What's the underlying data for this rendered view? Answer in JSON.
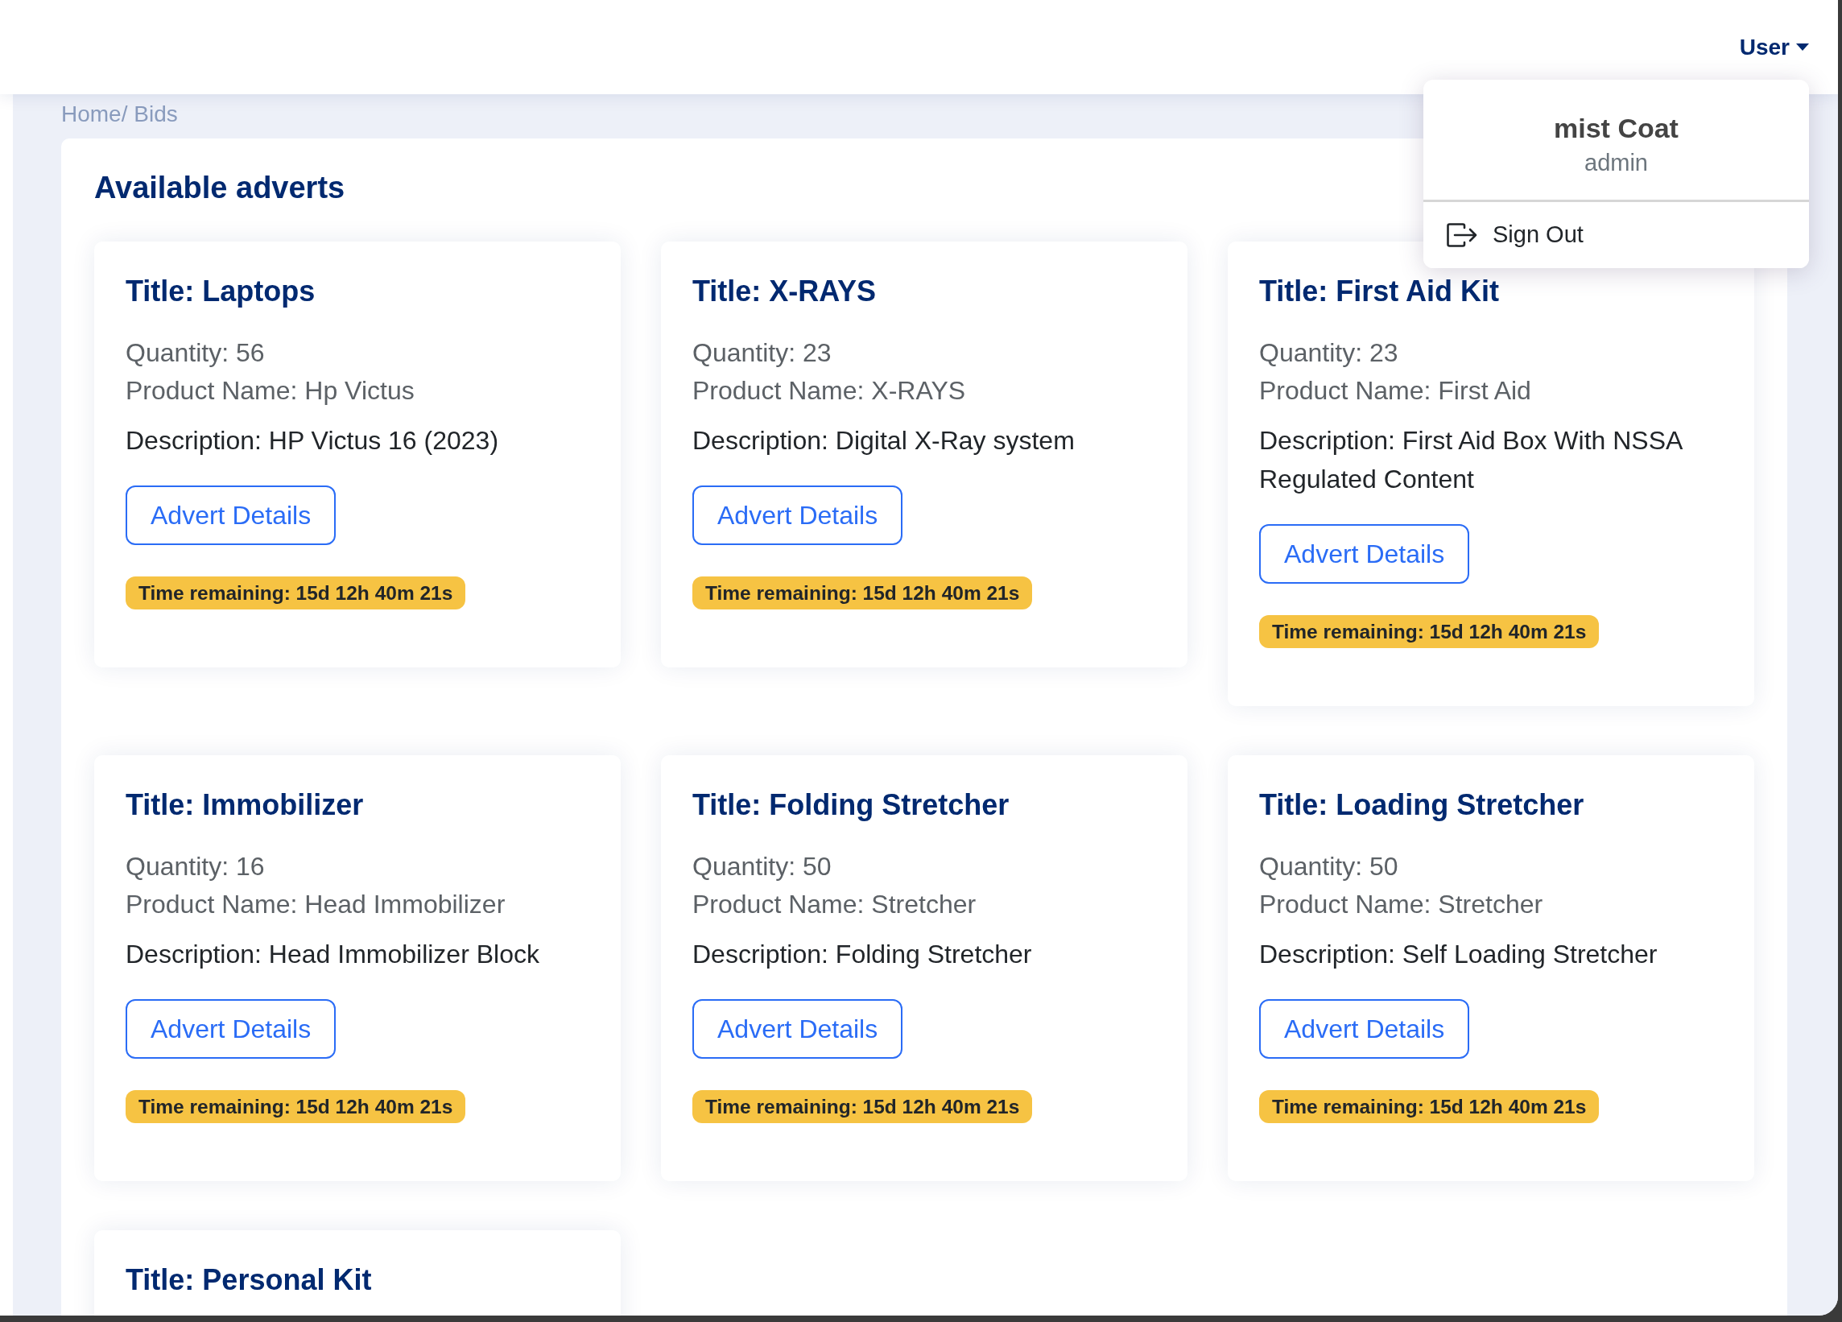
{
  "header": {
    "user_menu": {
      "label": "User",
      "expanded": true
    }
  },
  "user_dropdown": {
    "name": "mist Coat",
    "role": "admin",
    "items": [
      {
        "label": "Sign Out",
        "kind": "logout"
      }
    ]
  },
  "breadcrumb": "Home/ Bids",
  "adverts": {
    "title": "Available adverts",
    "cards": [
      {
        "title": "Title: Laptops",
        "quantity": "Quantity: 56",
        "product_name": "Product Name: Hp Victus",
        "description": "Description: HP Victus 16 (2023)",
        "button": "Advert Details",
        "time_remaining": "Time remaining: 15d 12h 40m 21s"
      },
      {
        "title": "Title: X-RAYS",
        "quantity": "Quantity: 23",
        "product_name": "Product Name: X-RAYS",
        "description": "Description: Digital X-Ray system",
        "button": "Advert Details",
        "time_remaining": "Time remaining: 15d 12h 40m 21s"
      },
      {
        "title": "Title: First Aid Kit",
        "quantity": "Quantity: 23",
        "product_name": "Product Name: First Aid",
        "description": "Description: First Aid Box With NSSA Regulated Content",
        "button": "Advert Details",
        "time_remaining": "Time remaining: 15d 12h 40m 21s"
      },
      {
        "title": "Title: Immobilizer",
        "quantity": "Quantity: 16",
        "product_name": "Product Name: Head Immobilizer",
        "description": "Description: Head Immobilizer Block",
        "button": "Advert Details",
        "time_remaining": "Time remaining: 15d 12h 40m 21s"
      },
      {
        "title": "Title: Folding Stretcher",
        "quantity": "Quantity: 50",
        "product_name": "Product Name: Stretcher",
        "description": "Description: Folding Stretcher",
        "button": "Advert Details",
        "time_remaining": "Time remaining: 15d 12h 40m 21s"
      },
      {
        "title": "Title: Loading Stretcher",
        "quantity": "Quantity: 50",
        "product_name": "Product Name: Stretcher",
        "description": "Description: Self Loading Stretcher",
        "button": "Advert Details",
        "time_remaining": "Time remaining: 15d 12h 40m 21s"
      },
      {
        "title": "Title: Personal Kit"
      }
    ]
  }
}
